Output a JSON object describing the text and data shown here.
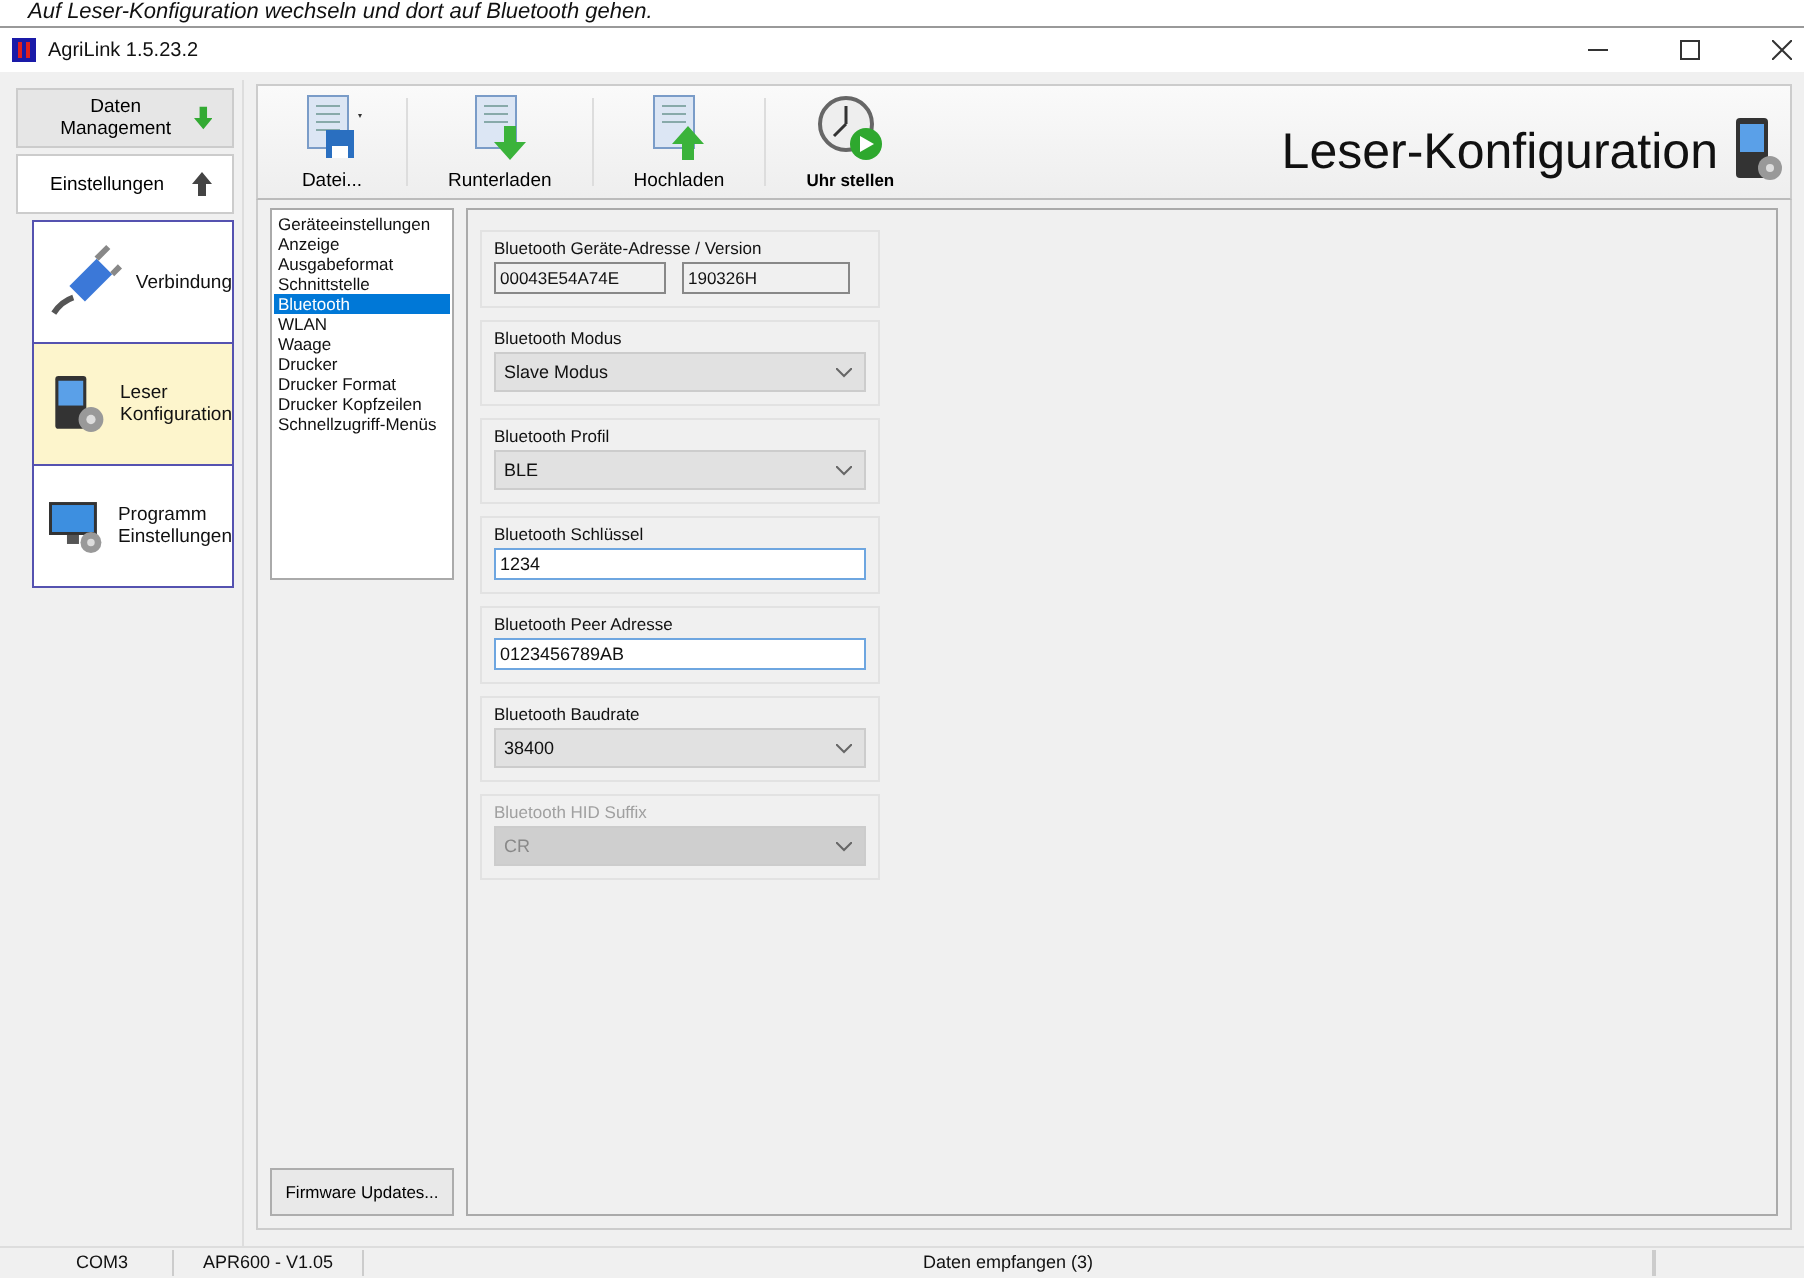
{
  "caption": "Auf Leser-Konfiguration wechseln und dort auf Bluetooth gehen.",
  "window": {
    "title": "AgriLink 1.5.23.2"
  },
  "nav_sections": [
    {
      "label": "Daten Management",
      "expanded": false
    },
    {
      "label": "Einstellungen",
      "expanded": true
    }
  ],
  "nav_items": [
    {
      "label": "Verbindung",
      "kind": "plug",
      "selected": false
    },
    {
      "label": "Leser\nKonfiguration",
      "kind": "device",
      "selected": true
    },
    {
      "label": "Programm\nEinstellungen",
      "kind": "monitor",
      "selected": false
    }
  ],
  "toolbar": [
    {
      "label": "Datei...",
      "kind": "save"
    },
    {
      "label": "Runterladen",
      "kind": "download"
    },
    {
      "label": "Hochladen",
      "kind": "upload"
    },
    {
      "label": "Uhr stellen",
      "kind": "clock"
    }
  ],
  "page_title": "Leser-Konfiguration",
  "categories": [
    {
      "label": "Geräteeinstellungen",
      "selected": false
    },
    {
      "label": "Anzeige",
      "selected": false
    },
    {
      "label": "Ausgabeformat",
      "selected": false
    },
    {
      "label": "Schnittstelle",
      "selected": false
    },
    {
      "label": "Bluetooth",
      "selected": true
    },
    {
      "label": "WLAN",
      "selected": false
    },
    {
      "label": "Waage",
      "selected": false
    },
    {
      "label": "Drucker",
      "selected": false
    },
    {
      "label": "Drucker Format",
      "selected": false
    },
    {
      "label": "Drucker Kopfzeilen",
      "selected": false
    },
    {
      "label": "Schnellzugriff-Menüs",
      "selected": false
    }
  ],
  "firmware_button": "Firmware Updates...",
  "groups": [
    {
      "label": "Bluetooth Geräte-Adresse / Version",
      "kind": "readonly",
      "values": [
        "00043E54A74E",
        "190326H"
      ],
      "disabled": false
    },
    {
      "label": "Bluetooth Modus",
      "kind": "select",
      "value": "Slave Modus",
      "disabled": false
    },
    {
      "label": "Bluetooth Profil",
      "kind": "select",
      "value": "BLE",
      "disabled": false
    },
    {
      "label": "Bluetooth Schlüssel",
      "kind": "input",
      "value": "1234",
      "disabled": false
    },
    {
      "label": "Bluetooth Peer Adresse",
      "kind": "input",
      "value": "0123456789AB",
      "disabled": false
    },
    {
      "label": "Bluetooth Baudrate",
      "kind": "select",
      "value": "38400",
      "disabled": false
    },
    {
      "label": "Bluetooth HID Suffix",
      "kind": "select",
      "value": "CR",
      "disabled": true
    }
  ],
  "status_bar": [
    "COM3",
    "APR600 - V1.05",
    "Daten empfangen (3)"
  ]
}
